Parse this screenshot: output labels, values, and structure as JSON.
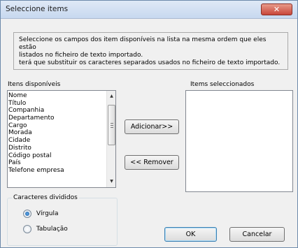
{
  "dialog": {
    "title": "Seleccione items",
    "close_icon": "close-x-icon",
    "close_glyph": "✕",
    "instructions": [
      "Seleccione os campos dos item disponíveis na lista na mesma ordem que eles estão",
      "listados no ficheiro de texto importado.",
      "terá que substituir os caracteres separados usados no ficheiro de texto importado."
    ]
  },
  "available": {
    "label": "Itens disponíveis",
    "items": [
      "Nome",
      "Título",
      "Companhia",
      "Departamento",
      "Cargo",
      "Morada",
      "Cidade",
      "Distrito",
      "Código postal",
      "País",
      "Telefone empresa"
    ]
  },
  "selected": {
    "label": "Items seleccionados",
    "items": []
  },
  "buttons": {
    "add": "Adicionar>>",
    "remove": "<< Remover",
    "ok": "OK",
    "cancel": "Cancelar"
  },
  "delimiters": {
    "label": "Caracteres divididos",
    "options": [
      {
        "label": "Vírgula",
        "selected": true
      },
      {
        "label": "Tabulação",
        "selected": false
      }
    ]
  },
  "scrollbar": {
    "up_icon": "scroll-up-icon",
    "down_icon": "scroll-down-icon",
    "up_glyph": "▲",
    "down_glyph": "▼"
  }
}
